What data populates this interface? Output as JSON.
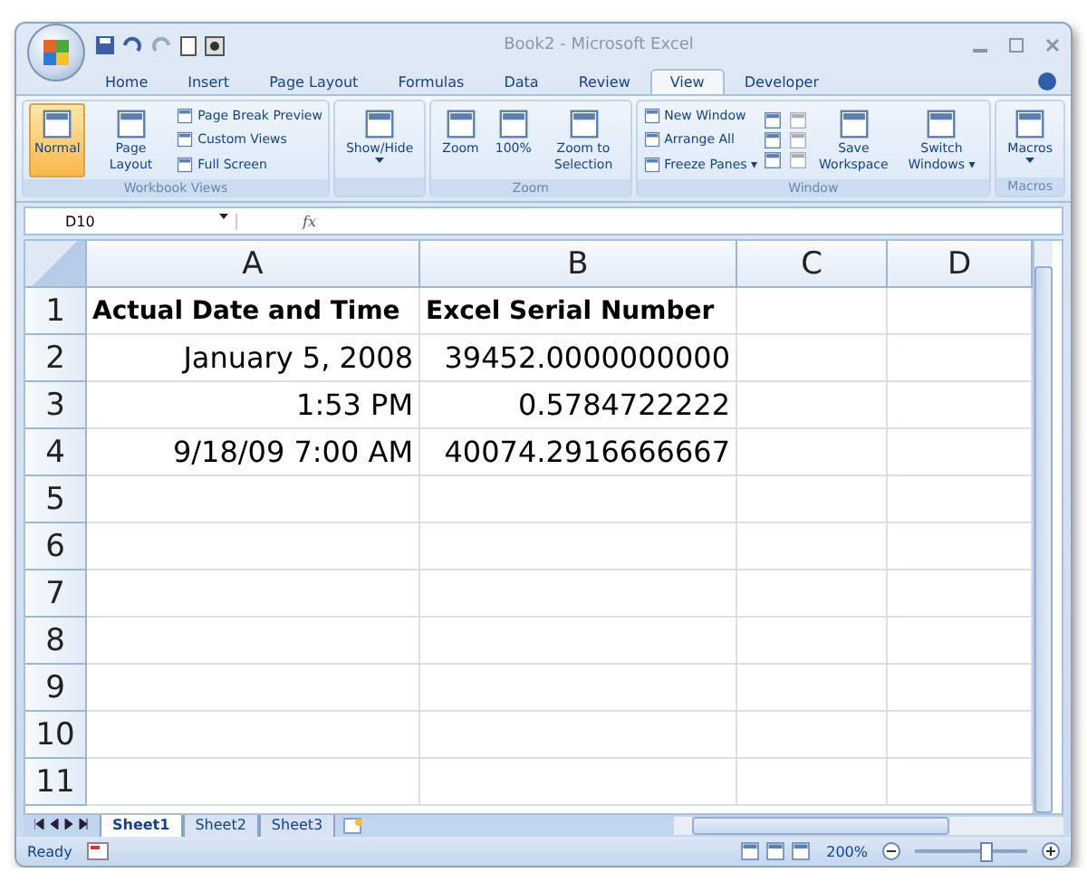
{
  "window": {
    "title": "Book2 - Microsoft Excel"
  },
  "tabs": [
    {
      "label": "Home",
      "selected": false
    },
    {
      "label": "Insert",
      "selected": false
    },
    {
      "label": "Page Layout",
      "selected": false
    },
    {
      "label": "Formulas",
      "selected": false
    },
    {
      "label": "Data",
      "selected": false
    },
    {
      "label": "Review",
      "selected": false
    },
    {
      "label": "View",
      "selected": true
    },
    {
      "label": "Developer",
      "selected": false
    }
  ],
  "ribbon": {
    "groups": [
      {
        "label": "Workbook Views",
        "large": [
          {
            "label": "Normal",
            "selected": true
          },
          {
            "label": "Page Layout",
            "selected": false
          }
        ],
        "small": [
          "Page Break Preview",
          "Custom Views",
          "Full Screen"
        ]
      },
      {
        "large": [
          {
            "label": "Show/Hide",
            "selected": false,
            "dropdown": true
          }
        ]
      },
      {
        "label": "Zoom",
        "large": [
          {
            "label": "Zoom",
            "selected": false
          },
          {
            "label": "100%",
            "selected": false
          },
          {
            "label": "Zoom to Selection",
            "selected": false
          }
        ]
      },
      {
        "label": "Window",
        "small": [
          "New Window",
          "Arrange All",
          "Freeze Panes ▾"
        ],
        "extra": true,
        "large_after": [
          {
            "label": "Save Workspace",
            "selected": false
          },
          {
            "label": "Switch Windows ▾",
            "selected": false
          }
        ]
      },
      {
        "label": "Macros",
        "large": [
          {
            "label": "Macros",
            "selected": false,
            "dropdown": true
          }
        ]
      }
    ]
  },
  "formula_bar": {
    "name_box": "D10",
    "function_label": "fx"
  },
  "sheet": {
    "columns": [
      "A",
      "B",
      "C",
      "D"
    ],
    "rows": [
      {
        "number": "1",
        "cells": [
          {
            "text": "Actual Date and Time",
            "kind": "header"
          },
          {
            "text": "Excel Serial Number",
            "kind": "header"
          },
          {
            "text": "",
            "kind": "empty"
          },
          {
            "text": "",
            "kind": "empty"
          }
        ]
      },
      {
        "number": "2",
        "cells": [
          {
            "text": "January 5, 2008",
            "kind": "value"
          },
          {
            "text": "39452.0000000000",
            "kind": "value"
          },
          {
            "text": "",
            "kind": "empty"
          },
          {
            "text": "",
            "kind": "empty"
          }
        ]
      },
      {
        "number": "3",
        "cells": [
          {
            "text": "1:53 PM",
            "kind": "value"
          },
          {
            "text": "0.5784722222",
            "kind": "value"
          },
          {
            "text": "",
            "kind": "empty"
          },
          {
            "text": "",
            "kind": "empty"
          }
        ]
      },
      {
        "number": "4",
        "cells": [
          {
            "text": "9/18/09 7:00 AM",
            "kind": "value"
          },
          {
            "text": "40074.2916666667",
            "kind": "value"
          },
          {
            "text": "",
            "kind": "empty"
          },
          {
            "text": "",
            "kind": "empty"
          }
        ]
      },
      {
        "number": "5",
        "cells": []
      },
      {
        "number": "6",
        "cells": []
      },
      {
        "number": "7",
        "cells": []
      },
      {
        "number": "8",
        "cells": []
      },
      {
        "number": "9",
        "cells": []
      },
      {
        "number": "10",
        "cells": []
      },
      {
        "number": "11",
        "cells": []
      }
    ]
  },
  "sheet_tabs": [
    {
      "label": "Sheet1",
      "selected": true
    },
    {
      "label": "Sheet2",
      "selected": false
    },
    {
      "label": "Sheet3",
      "selected": false
    }
  ],
  "status_bar": {
    "status": "Ready",
    "zoom": "200%",
    "zoom_slider": {
      "level": 0.62
    }
  }
}
